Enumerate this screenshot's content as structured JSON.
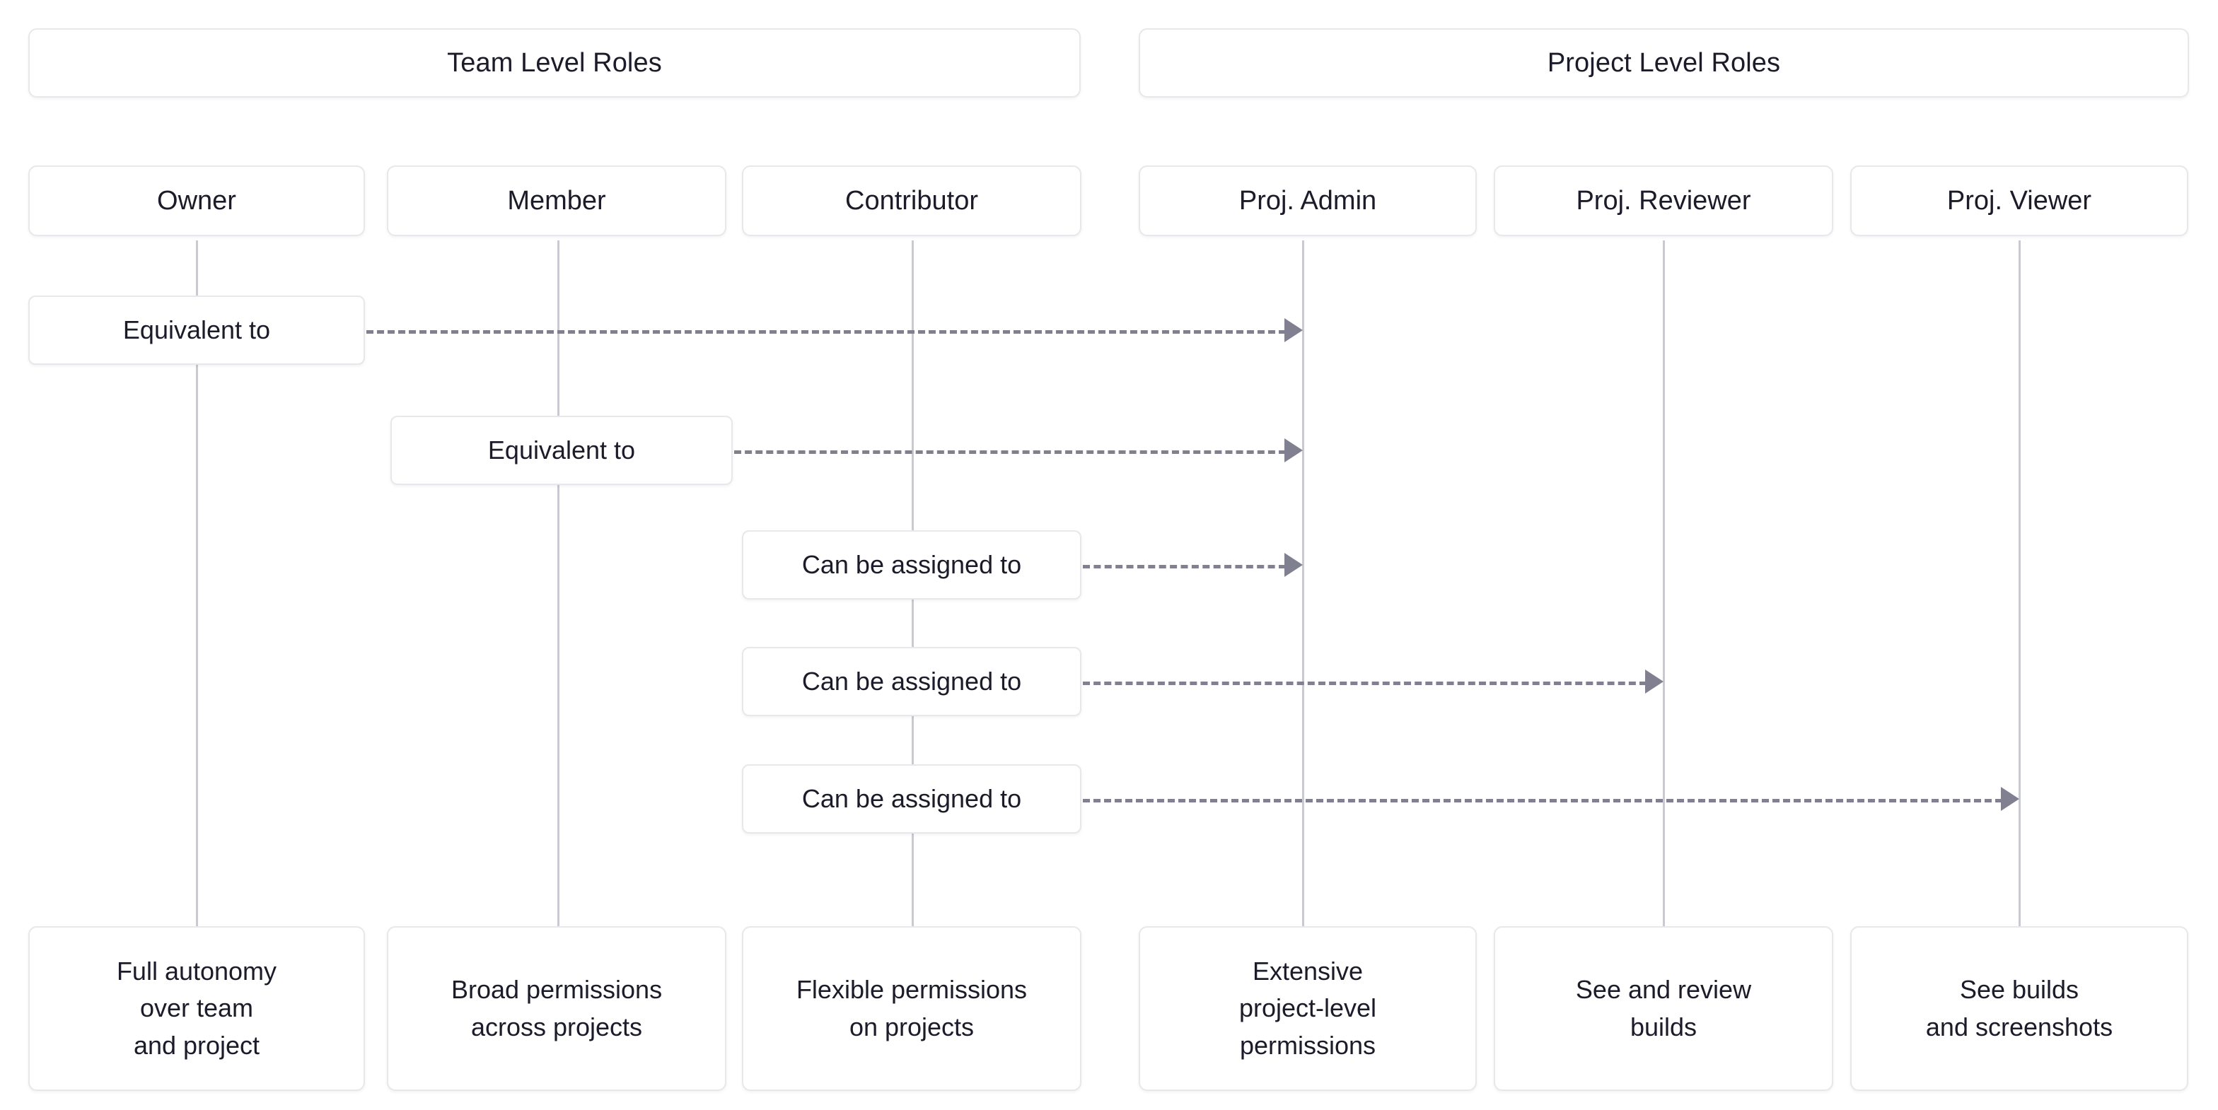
{
  "diagram": {
    "title_visible": false,
    "groups": [
      {
        "id": "team",
        "label": "Team Level Roles"
      },
      {
        "id": "project",
        "label": "Project Level Roles"
      }
    ],
    "roles": [
      {
        "id": "owner",
        "label": "Owner",
        "group": "team",
        "description": [
          "Full autonomy",
          "over team",
          "and project"
        ]
      },
      {
        "id": "member",
        "label": "Member",
        "group": "team",
        "description": [
          "Broad permissions",
          "across projects"
        ]
      },
      {
        "id": "contributor",
        "label": "Contributor",
        "group": "team",
        "description": [
          "Flexible permissions",
          "on projects"
        ]
      },
      {
        "id": "proj-admin",
        "label": "Proj. Admin",
        "group": "project",
        "description": [
          "Extensive",
          "project-level",
          "permissions"
        ]
      },
      {
        "id": "proj-reviewer",
        "label": "Proj. Reviewer",
        "group": "project",
        "description": [
          "See and review",
          "builds"
        ]
      },
      {
        "id": "proj-viewer",
        "label": "Proj. Viewer",
        "group": "project",
        "description": [
          "See builds",
          "and screenshots"
        ]
      }
    ],
    "relations": [
      {
        "id": "rel-1",
        "from": "owner",
        "to": "proj-admin",
        "label": "Equivalent to"
      },
      {
        "id": "rel-2",
        "from": "member",
        "to": "proj-admin",
        "label": "Equivalent to"
      },
      {
        "id": "rel-3",
        "from": "contributor",
        "to": "proj-admin",
        "label": "Can be assigned to"
      },
      {
        "id": "rel-4",
        "from": "contributor",
        "to": "proj-reviewer",
        "label": "Can be assigned to"
      },
      {
        "id": "rel-5",
        "from": "contributor",
        "to": "proj-viewer",
        "label": "Can be assigned to"
      }
    ],
    "colors": {
      "card_border": "#e8e8ec",
      "card_background": "#ffffff",
      "text": "#1b1b29",
      "lifeline": "#c9c9d1",
      "connector": "#808091",
      "page_background": "#ffffff"
    }
  }
}
